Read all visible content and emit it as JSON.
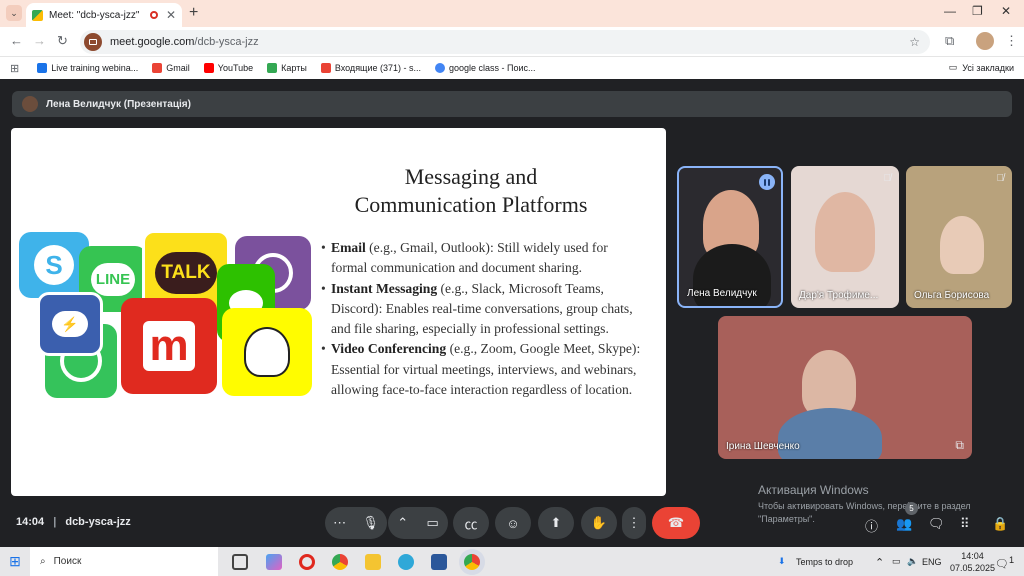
{
  "browser": {
    "tab_title": "Meet: \"dcb-ysca-jzz\"",
    "tab_close": "✕",
    "new_tab": "+",
    "url_host": "meet.google.com",
    "url_path": "/dcb-ysca-jzz",
    "bookmarks": [
      {
        "label": "Live training webina...",
        "color": "#1a73e8"
      },
      {
        "label": "Gmail",
        "color": "#ea4335"
      },
      {
        "label": "YouTube",
        "color": "#ff0000"
      },
      {
        "label": "Карты",
        "color": "#34a853"
      },
      {
        "label": "Входящие (371) - s...",
        "color": "#ea4335"
      },
      {
        "label": "google class - Поис...",
        "color": "#4285f4"
      }
    ],
    "all_bookmarks": "Усі закладки"
  },
  "meet": {
    "presenter_label": "Лена Велидчук (Презентація)",
    "slide": {
      "title_line1": "Messaging and",
      "title_line2": "Communication Platforms",
      "bullets": [
        {
          "bold": "Email",
          "text": " (e.g., Gmail, Outlook): Still widely used for formal communication and document sharing."
        },
        {
          "bold": "Instant Messaging",
          "text": " (e.g., Slack, Microsoft Teams, Discord): Enables real-time conversations, group chats, and file sharing, especially in professional settings."
        },
        {
          "bold": "Video Conferencing",
          "text": " (e.g., Zoom, Google Meet, Skype): Essential for virtual meetings, interviews, and webinars, allowing face-to-face interaction regardless of location."
        }
      ],
      "logo_talk": "TALK",
      "logo_line": "LINE"
    },
    "participants": [
      {
        "name": "Лена Велидчук"
      },
      {
        "name": "Дар'я Трофиме..."
      },
      {
        "name": "Ольга Борисова"
      },
      {
        "name": "Ірина Шевченко"
      }
    ],
    "time": "14:04",
    "meeting_code": "dcb-ysca-jzz",
    "participant_count": "5",
    "activate_title": "Активация Windows",
    "activate_text_1": "Чтобы активировать Windows, перейдите в раздел",
    "activate_text_2": "\"Параметры\"."
  },
  "taskbar": {
    "search_placeholder": "Поиск",
    "weather": "Temps to drop",
    "lang": "ENG",
    "clock_time": "14:04",
    "clock_date": "07.05.2025",
    "notif_count": "1"
  }
}
